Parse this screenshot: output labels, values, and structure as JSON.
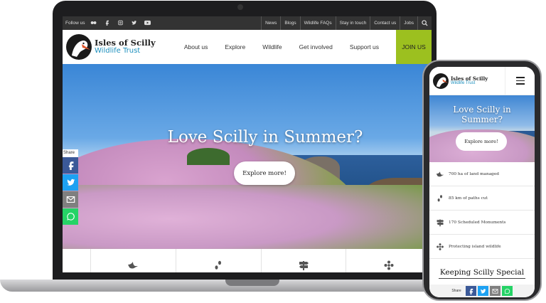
{
  "colors": {
    "facebook": "#3b5998",
    "twitter": "#1da1f2",
    "email": "#7f7f7f",
    "whatsapp": "#25d366",
    "join_accent": "#9cc01f",
    "brand_blue": "#1c8fbd"
  },
  "laptop": {
    "topbar": {
      "follow_label": "Follow us",
      "social_icons": [
        "flickr-icon",
        "facebook-icon",
        "instagram-icon",
        "twitter-icon",
        "youtube-icon"
      ],
      "links": [
        "News",
        "Blogs",
        "Wildlife FAQs",
        "Stay in touch",
        "Contact us",
        "Jobs"
      ],
      "search_icon": "search-icon"
    },
    "logo": {
      "line1": "Isles of Scilly",
      "line2": "Wildlife Trust"
    },
    "nav": {
      "items": [
        "About us",
        "Explore",
        "Wildlife",
        "Get involved",
        "Support us"
      ],
      "join": "JOIN US"
    },
    "hero": {
      "title": "Love Scilly in Summer?",
      "button": "Explore more!"
    },
    "share": {
      "label": "Share",
      "buttons": [
        "facebook-icon",
        "twitter-icon",
        "email-icon",
        "whatsapp-icon"
      ]
    },
    "stats_icons": [
      "bird-icon",
      "footprints-icon",
      "signpost-icon",
      "flower-icon"
    ]
  },
  "phone": {
    "logo": {
      "line1": "Isles of Scilly",
      "line2": "Wildlife Trust"
    },
    "menu_icon": "hamburger-menu-icon",
    "hero": {
      "title_line1": "Love Scilly in",
      "title_line2": "Summer?",
      "button": "Explore more!"
    },
    "stats": [
      {
        "icon": "bird-icon",
        "text": "700 ha of land managed"
      },
      {
        "icon": "footprints-icon",
        "text": "85 km of paths cut"
      },
      {
        "icon": "signpost-icon",
        "text": "170 Scheduled Monuments"
      },
      {
        "icon": "flower-icon",
        "text": "Protecting island wildlife"
      }
    ],
    "keeping": "Keeping Scilly Special",
    "share": {
      "label": "Share"
    }
  }
}
